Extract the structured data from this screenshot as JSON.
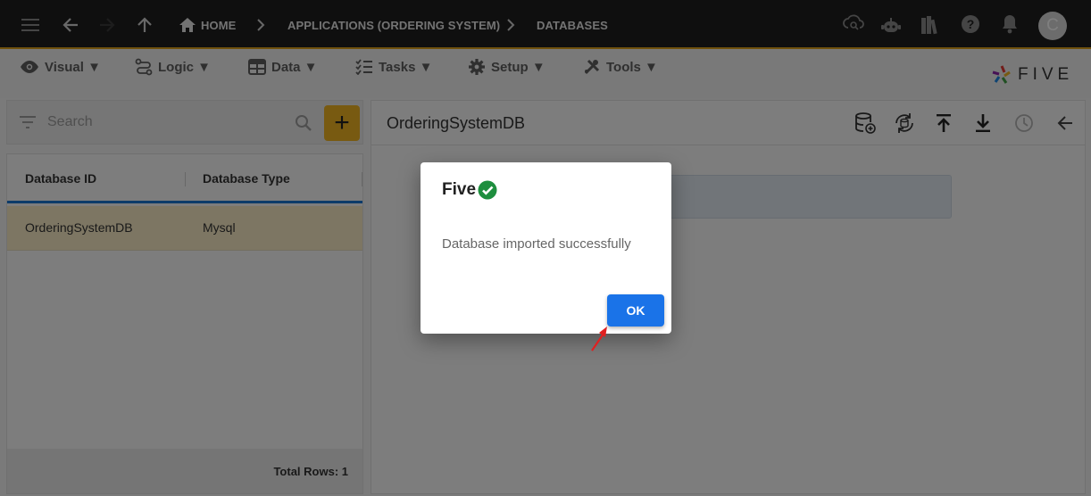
{
  "breadcrumb": {
    "home": "HOME",
    "applications": "APPLICATIONS (ORDERING SYSTEM)",
    "databases": "DATABASES"
  },
  "user": {
    "avatar_initial": "C"
  },
  "menu": {
    "visual": "Visual ▼",
    "logic": "Logic ▼",
    "data": "Data ▼",
    "tasks": "Tasks ▼",
    "setup": "Setup ▼",
    "tools": "Tools ▼"
  },
  "logo": {
    "text": "FIVE"
  },
  "list": {
    "search_placeholder": "Search",
    "add_label": "+",
    "columns": [
      "Database ID",
      "Database Type"
    ],
    "rows": [
      {
        "id": "OrderingSystemDB",
        "type": "Mysql"
      }
    ],
    "total_rows": "Total Rows: 1"
  },
  "detail": {
    "title": "OrderingSystemDB"
  },
  "dialog": {
    "title": "Five",
    "message": "Database imported successfully",
    "ok_label": "OK"
  },
  "colors": {
    "topbar": "#1f1f1f",
    "accent": "#e0a21a",
    "add_button": "#f1b522",
    "primary": "#1a73e8",
    "success": "#1e8e3e",
    "selected_row": "#faecc6"
  }
}
